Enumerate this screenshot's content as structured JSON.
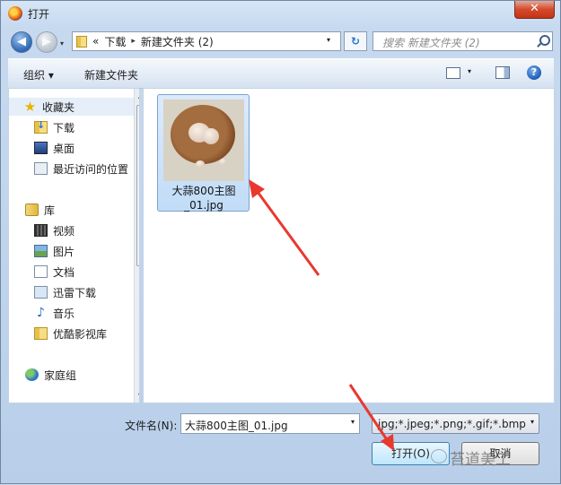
{
  "window": {
    "title": "打开",
    "close_glyph": "✕"
  },
  "nav": {
    "back_glyph": "◀",
    "forward_glyph": "▶",
    "history_glyph": "▾"
  },
  "address": {
    "prefix": "«",
    "crumbs": [
      "下载",
      "新建文件夹 (2)"
    ],
    "separator_glyph": "▸",
    "dropdown_glyph": "▾"
  },
  "refresh_glyph": "↻",
  "search": {
    "placeholder": "搜索 新建文件夹 (2)"
  },
  "toolbar": {
    "organize_label": "组织 ▾",
    "new_folder_label": "新建文件夹",
    "view_drop_glyph": "▾",
    "help_glyph": "?"
  },
  "sidebar": {
    "items": [
      {
        "label": "收藏夹",
        "icon": "star-icon"
      },
      {
        "label": "下载",
        "icon": "download-folder-icon"
      },
      {
        "label": "桌面",
        "icon": "desktop-icon"
      },
      {
        "label": "最近访问的位置",
        "icon": "recent-places-icon"
      },
      {
        "label": "库",
        "icon": "library-icon"
      },
      {
        "label": "视频",
        "icon": "video-icon"
      },
      {
        "label": "图片",
        "icon": "pictures-icon"
      },
      {
        "label": "文档",
        "icon": "documents-icon"
      },
      {
        "label": "迅雷下载",
        "icon": "xunlei-folder-icon"
      },
      {
        "label": "音乐",
        "icon": "music-icon"
      },
      {
        "label": "优酷影视库",
        "icon": "youku-folder-icon"
      },
      {
        "label": "家庭组",
        "icon": "homegroup-icon"
      }
    ],
    "scroll_up": "▲",
    "scroll_down": "▼",
    "grip": "≡"
  },
  "files": [
    {
      "name": "大蒜800主图_01.jpg",
      "selected": true
    }
  ],
  "footer": {
    "filename_label": "文件名(N):",
    "filename_value": "大蒜800主图_01.jpg",
    "filename_drop": "▾",
    "filter_value": "jpg;*.jpeg;*.png;*.gif;*.bmp",
    "filter_drop": "▾",
    "open_label": "打开(O)",
    "cancel_label": "取消"
  },
  "watermark": "苔道美工",
  "colors": {
    "annotation_arrow": "#e8392f",
    "selection": "#c8dff8"
  }
}
